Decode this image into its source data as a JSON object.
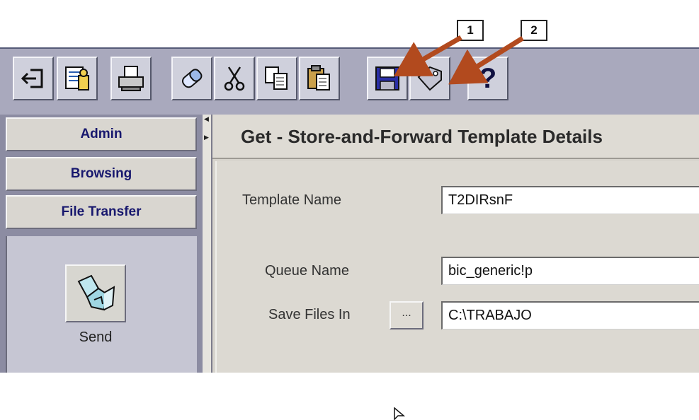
{
  "callouts": [
    "1",
    "2"
  ],
  "toolbar": {
    "buttons": [
      {
        "name": "logout-icon"
      },
      {
        "name": "directory-icon"
      },
      {
        "name": "print-icon"
      },
      {
        "name": "eraser-icon"
      },
      {
        "name": "cut-icon"
      },
      {
        "name": "copy-icon"
      },
      {
        "name": "paste-icon"
      },
      {
        "name": "save-icon"
      },
      {
        "name": "tag-icon"
      },
      {
        "name": "help-icon",
        "label": "?"
      }
    ]
  },
  "nav": {
    "items": [
      "Admin",
      "Browsing",
      "File Transfer"
    ],
    "send_label": "Send"
  },
  "page": {
    "title": "Get - Store-and-Forward Template Details"
  },
  "form": {
    "template_name": {
      "label": "Template Name",
      "value": "T2DIRsnF"
    },
    "queue_name": {
      "label": "Queue Name",
      "value": "bic_generic!p"
    },
    "save_files_in": {
      "label": "Save Files In",
      "value": "C:\\TRABAJO",
      "browse_label": "..."
    }
  },
  "colors": {
    "arrow": "#b24a1e",
    "nav_text": "#18186e",
    "toolbar": "#a9a9bd"
  }
}
